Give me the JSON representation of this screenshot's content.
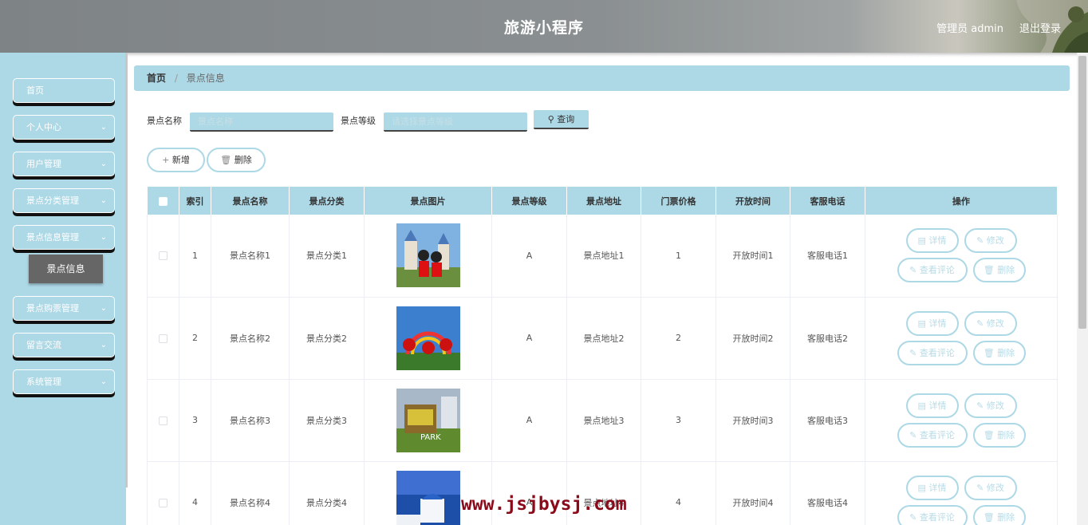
{
  "header": {
    "title": "旅游小程序",
    "user": "管理员 admin",
    "logout": "退出登录"
  },
  "sidebar": {
    "items": [
      {
        "label": "首页",
        "has_chevron": false
      },
      {
        "label": "个人中心",
        "has_chevron": true
      },
      {
        "label": "用户管理",
        "has_chevron": true
      },
      {
        "label": "景点分类管理",
        "has_chevron": true
      },
      {
        "label": "景点信息管理",
        "has_chevron": true
      },
      {
        "label": "景点购票管理",
        "has_chevron": true
      },
      {
        "label": "留言交流",
        "has_chevron": true
      },
      {
        "label": "系统管理",
        "has_chevron": true
      }
    ],
    "active_sub": "景点信息"
  },
  "breadcrumb": {
    "home": "首页",
    "sep": "/",
    "current": "景点信息"
  },
  "search": {
    "name_label": "景点名称",
    "name_placeholder": "景点名称",
    "level_label": "景点等级",
    "level_placeholder": "请选择景点等级",
    "query_label": "查询"
  },
  "actions": {
    "add_label": "新增",
    "delete_label": "删除"
  },
  "table": {
    "headers": [
      "",
      "索引",
      "景点名称",
      "景点分类",
      "景点图片",
      "景点等级",
      "景点地址",
      "门票价格",
      "开放时间",
      "客服电话",
      "操作"
    ],
    "rows": [
      {
        "index": "1",
        "name": "景点名称1",
        "category": "景点分类1",
        "level": "A",
        "address": "景点地址1",
        "price": "1",
        "open": "开放时间1",
        "phone": "客服电话1"
      },
      {
        "index": "2",
        "name": "景点名称2",
        "category": "景点分类2",
        "level": "A",
        "address": "景点地址2",
        "price": "2",
        "open": "开放时间2",
        "phone": "客服电话2"
      },
      {
        "index": "3",
        "name": "景点名称3",
        "category": "景点分类3",
        "level": "A",
        "address": "景点地址3",
        "price": "3",
        "open": "开放时间3",
        "phone": "客服电话3"
      },
      {
        "index": "4",
        "name": "景点名称4",
        "category": "景点分类4",
        "level": "A",
        "address": "景点地址4",
        "price": "4",
        "open": "开放时间4",
        "phone": "客服电话4"
      }
    ],
    "row_ops": {
      "detail": "详情",
      "edit": "修改",
      "comments": "查看评论",
      "delete": "删除"
    }
  },
  "watermark": "www.jsjbysj.com",
  "colors": {
    "accent": "#add8e6",
    "header_bg": "#8a8f91",
    "watermark": "#8b0a1a"
  }
}
